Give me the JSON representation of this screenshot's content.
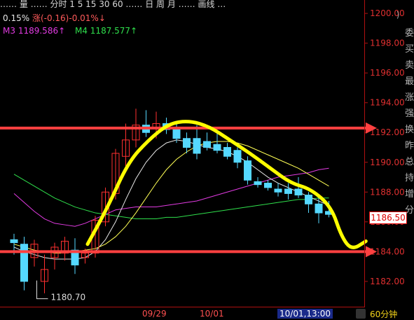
{
  "header": {
    "truncated_text": "…… 量 …… 分时 1 5 15 30 60 …… 日 周 月 …… 画线 …",
    "stats_pct": "0.15%",
    "stats_chg": "涨(-0.16)-0.01%↓",
    "ma3_label": "M3",
    "ma3_value": "1189.586↑",
    "ma4_label": "M4",
    "ma4_value": "1187.577↑"
  },
  "side_panel_chars": "委买卖最涨强换昨总持增分",
  "timeframe_label": "60分钟",
  "last_price_tag": "1186.50",
  "low_label": "1180.70",
  "colors": {
    "background": "#000000",
    "axis": "#b01010",
    "candle_up": "#ff3030",
    "candle_down": "#55d8ff",
    "ma3": "#e23be2",
    "ma4": "#2fe04c",
    "white_ma": "#e8e8e8",
    "yellow_ma": "#ffff55",
    "annotation_yellow": "#ffff00",
    "annotation_red": "#ff4040"
  },
  "chart_data": {
    "type": "candlestick",
    "y_axis": {
      "ticks": [
        1182,
        1184,
        1186,
        1188,
        1190,
        1192,
        1194,
        1196,
        1198,
        1200
      ],
      "tick_labels": [
        "1182.00",
        "1184.00",
        "1186.00",
        "1188.00",
        "1190.00",
        "1192.00",
        "1194.00",
        "1196.00",
        "1198.00",
        "1200.00"
      ],
      "range": [
        1180.3,
        1200.9
      ]
    },
    "x_labels": [
      "09/29",
      "10/01",
      "10/01,13:00"
    ],
    "candles": [
      {
        "o": 1184.8,
        "h": 1185.2,
        "l": 1183.8,
        "c": 1184.6
      },
      {
        "o": 1184.5,
        "h": 1185.0,
        "l": 1181.4,
        "c": 1182.0
      },
      {
        "o": 1183.6,
        "h": 1184.8,
        "l": 1183.0,
        "c": 1184.5
      },
      {
        "o": 1182.0,
        "h": 1183.8,
        "l": 1181.2,
        "c": 1182.8
      },
      {
        "o": 1183.6,
        "h": 1184.6,
        "l": 1182.8,
        "c": 1184.3
      },
      {
        "o": 1183.9,
        "h": 1185.0,
        "l": 1183.4,
        "c": 1184.7
      },
      {
        "o": 1184.1,
        "h": 1184.9,
        "l": 1182.5,
        "c": 1183.1
      },
      {
        "o": 1183.6,
        "h": 1184.2,
        "l": 1183.2,
        "c": 1183.9
      },
      {
        "o": 1183.9,
        "h": 1186.4,
        "l": 1183.6,
        "c": 1186.1
      },
      {
        "o": 1186.0,
        "h": 1188.3,
        "l": 1185.7,
        "c": 1188.0
      },
      {
        "o": 1187.9,
        "h": 1190.9,
        "l": 1187.5,
        "c": 1190.6
      },
      {
        "o": 1190.4,
        "h": 1192.6,
        "l": 1189.7,
        "c": 1191.5
      },
      {
        "o": 1191.5,
        "h": 1193.6,
        "l": 1191.0,
        "c": 1192.5
      },
      {
        "o": 1192.5,
        "h": 1193.5,
        "l": 1191.7,
        "c": 1192.0
      },
      {
        "o": 1192.3,
        "h": 1193.4,
        "l": 1191.6,
        "c": 1192.6
      },
      {
        "o": 1192.6,
        "h": 1193.0,
        "l": 1191.9,
        "c": 1192.2
      },
      {
        "o": 1192.2,
        "h": 1192.6,
        "l": 1191.3,
        "c": 1191.6
      },
      {
        "o": 1191.6,
        "h": 1192.0,
        "l": 1190.6,
        "c": 1191.0
      },
      {
        "o": 1191.6,
        "h": 1192.5,
        "l": 1190.2,
        "c": 1190.6
      },
      {
        "o": 1191.4,
        "h": 1192.0,
        "l": 1190.8,
        "c": 1191.0
      },
      {
        "o": 1191.2,
        "h": 1192.0,
        "l": 1190.6,
        "c": 1190.8
      },
      {
        "o": 1191.0,
        "h": 1191.3,
        "l": 1190.2,
        "c": 1190.4
      },
      {
        "o": 1190.8,
        "h": 1191.0,
        "l": 1189.6,
        "c": 1190.0
      },
      {
        "o": 1190.1,
        "h": 1190.4,
        "l": 1188.5,
        "c": 1188.8
      },
      {
        "o": 1188.7,
        "h": 1189.0,
        "l": 1188.3,
        "c": 1188.5
      },
      {
        "o": 1188.6,
        "h": 1188.8,
        "l": 1188.1,
        "c": 1188.3
      },
      {
        "o": 1188.2,
        "h": 1188.6,
        "l": 1187.7,
        "c": 1188.0
      },
      {
        "o": 1188.2,
        "h": 1188.6,
        "l": 1187.5,
        "c": 1187.9
      },
      {
        "o": 1188.2,
        "h": 1189.0,
        "l": 1187.6,
        "c": 1187.8
      },
      {
        "o": 1187.8,
        "h": 1188.0,
        "l": 1186.6,
        "c": 1187.2
      },
      {
        "o": 1187.2,
        "h": 1187.6,
        "l": 1185.9,
        "c": 1186.6
      },
      {
        "o": 1186.7,
        "h": 1187.4,
        "l": 1186.3,
        "c": 1186.5
      }
    ],
    "series": [
      {
        "name": "M3",
        "values": [
          1187.9,
          1187.3,
          1186.7,
          1186.2,
          1185.9,
          1185.8,
          1185.7,
          1185.9,
          1186.2,
          1186.5,
          1186.8,
          1186.9,
          1187.0,
          1187.0,
          1187.0,
          1187.1,
          1187.2,
          1187.3,
          1187.4,
          1187.6,
          1187.8,
          1188.0,
          1188.2,
          1188.4,
          1188.6,
          1188.8,
          1189.0,
          1189.1,
          1189.2,
          1189.3,
          1189.5,
          1189.6
        ]
      },
      {
        "name": "M4",
        "values": [
          1189.2,
          1188.8,
          1188.4,
          1188.0,
          1187.6,
          1187.3,
          1187.0,
          1186.8,
          1186.6,
          1186.5,
          1186.4,
          1186.3,
          1186.2,
          1186.2,
          1186.2,
          1186.3,
          1186.3,
          1186.4,
          1186.5,
          1186.6,
          1186.7,
          1186.8,
          1186.9,
          1187.0,
          1187.1,
          1187.2,
          1187.3,
          1187.4,
          1187.5,
          1187.5,
          1187.6,
          1187.6
        ]
      },
      {
        "values": [
          1184.3,
          1184.0,
          1183.8,
          1183.6,
          1183.5,
          1183.5,
          1183.5,
          1183.6,
          1184.0,
          1184.8,
          1186.0,
          1187.5,
          1188.9,
          1190.0,
          1190.8,
          1191.3,
          1191.5,
          1191.4,
          1191.2,
          1191.0,
          1190.9,
          1190.7,
          1190.4,
          1190.0,
          1189.5,
          1189.0,
          1188.6,
          1188.3,
          1188.0,
          1187.7,
          1187.4,
          1187.1
        ]
      },
      {
        "values": [
          1184.5,
          1184.3,
          1184.1,
          1184.0,
          1183.9,
          1183.9,
          1184.0,
          1184.1,
          1184.2,
          1184.5,
          1185.0,
          1185.7,
          1186.6,
          1187.6,
          1188.6,
          1189.5,
          1190.2,
          1190.7,
          1191.1,
          1191.3,
          1191.4,
          1191.4,
          1191.3,
          1191.1,
          1190.8,
          1190.5,
          1190.2,
          1189.9,
          1189.6,
          1189.2,
          1188.8,
          1188.4
        ]
      }
    ],
    "annotations": {
      "horizontal_arrows": [
        1192.3,
        1184.0
      ],
      "freehand_curve": [
        [
          0,
          1184.5
        ],
        [
          1,
          1187.0
        ],
        [
          2,
          1190.0
        ],
        [
          3,
          1191.5
        ],
        [
          4,
          1192.6
        ],
        [
          5,
          1192.8
        ],
        [
          6,
          1192.4
        ],
        [
          7,
          1191.5
        ],
        [
          8,
          1190.6
        ],
        [
          9,
          1189.6
        ],
        [
          10,
          1188.6
        ],
        [
          11,
          1188.2
        ],
        [
          12,
          1187.0
        ],
        [
          12.5,
          1185.0
        ],
        [
          13,
          1184.1
        ],
        [
          13.7,
          1184.7
        ]
      ]
    }
  }
}
